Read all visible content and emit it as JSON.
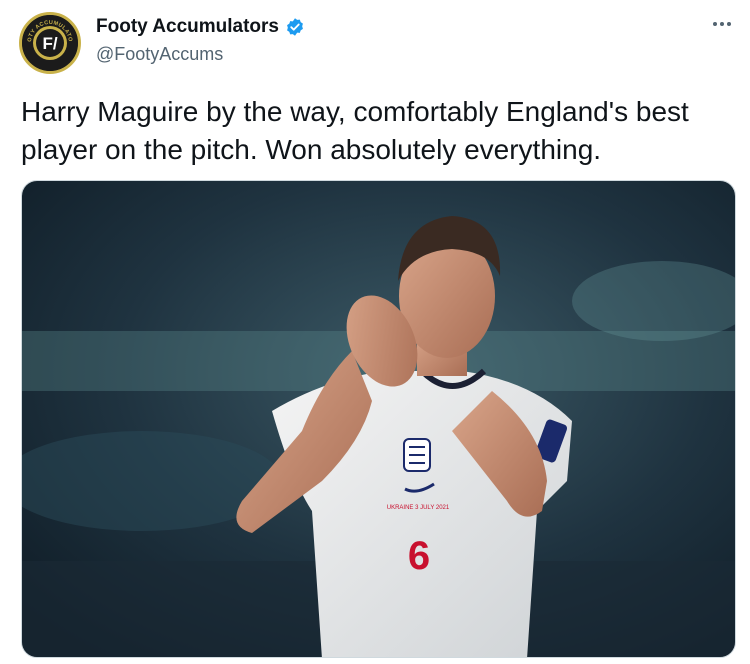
{
  "author": {
    "display_name": "Footy Accumulators",
    "handle": "@FootyAccums",
    "verified": true,
    "avatar_icon": "footy-accumulators-logo",
    "avatar_text": "FOOTY ACCUMULATORS"
  },
  "menu": {
    "icon": "more-options-icon"
  },
  "tweet": {
    "text": "Harry Maguire by the way, comfortably England's best player on the pitch. Won absolutely everything."
  },
  "media": {
    "kit_text": "UKRAINE 3 JULY 2021",
    "shirt_number": "6",
    "accent_color": "#1d9bf0",
    "number_color": "#c8102e"
  }
}
